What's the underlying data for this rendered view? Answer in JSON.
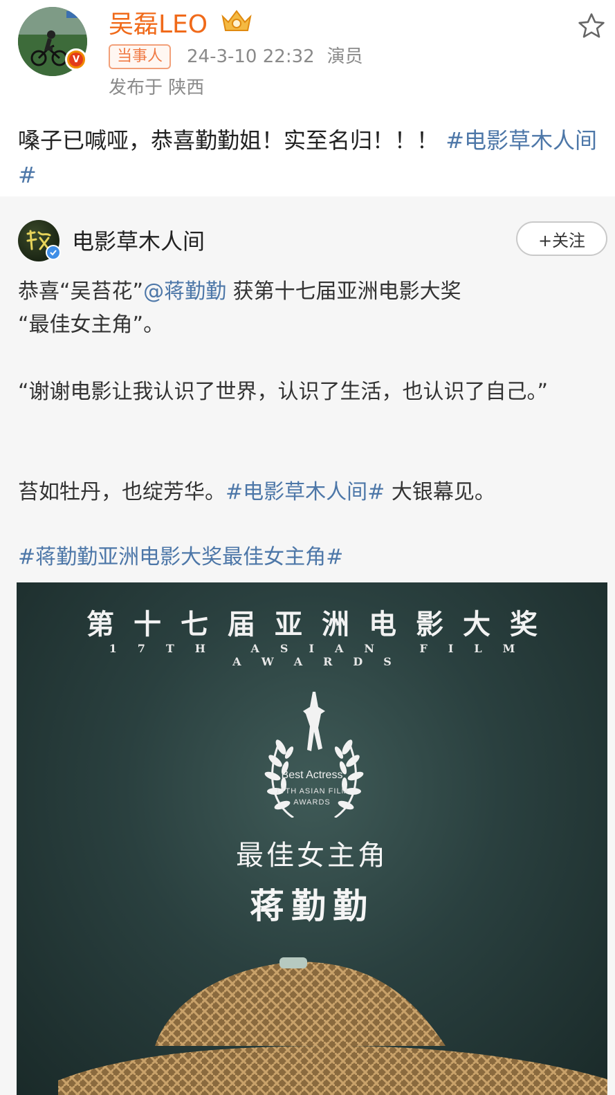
{
  "post": {
    "username": "吴磊LEO",
    "tag": "当事人",
    "datetime": "24-3-10 22:32",
    "role": "演员",
    "location": "发布于 陕西",
    "text_before_topic": "嗓子已喊哑，恭喜勤勤姐！实至名归！！！",
    "topic": "#电影草木人间#",
    "icons": {
      "favorite": "star-outline-icon",
      "verified": "verified-v-icon",
      "badge": "crown-badge-icon"
    },
    "colors": {
      "username": "#f06a1a",
      "link": "#4d77a8",
      "tag_border": "#f2a079"
    }
  },
  "repost": {
    "author": "电影草木人间",
    "follow_label": "+关注",
    "p1": {
      "pre": "恭喜“吴苔花”",
      "mention": "@蒋勤勤",
      "post1": " 获第十七届亚洲电影大奖",
      "post2": "“最佳女主角”。"
    },
    "p2": "“谢谢电影让我认识了世界，认识了生活，也认识了自己。”",
    "p3": {
      "pre": "苔如牡丹，也绽芳华。",
      "topic": "#电影草木人间#",
      "post": " 大银幕见。"
    },
    "p4_topic": "#蒋勤勤亚洲电影大奖最佳女主角#"
  },
  "poster": {
    "title": "第十七届亚洲电影大奖",
    "subtitle": "17TH ASIAN FILM AWARDS",
    "badge_line1": "Best Actress",
    "badge_line2": "17TH ASIAN FILM",
    "badge_line3": "AWARDS",
    "award_cn": "最佳女主角",
    "winner": "蒋勤勤"
  }
}
